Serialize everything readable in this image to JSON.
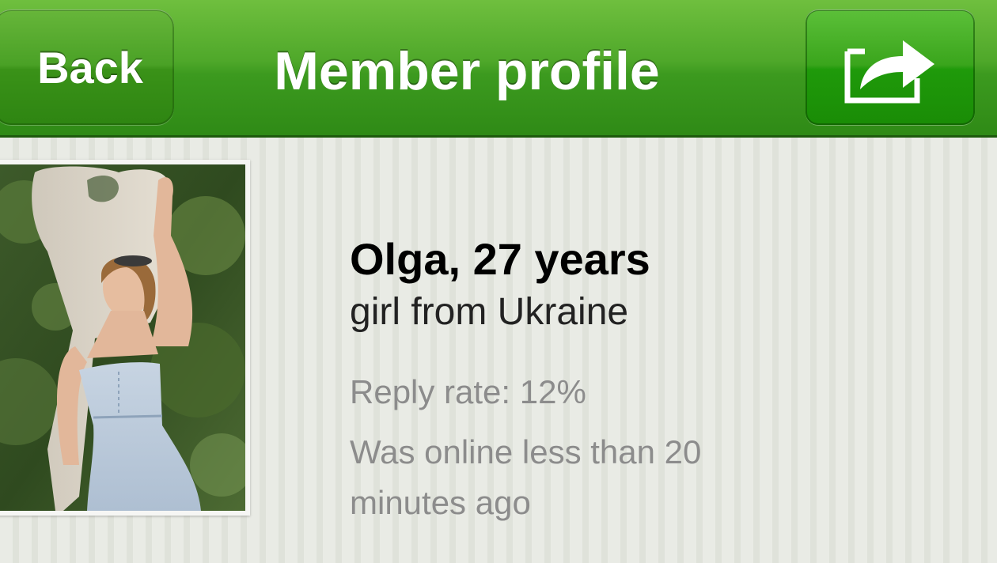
{
  "header": {
    "back_label": "Back",
    "title": "Member profile",
    "share_icon": "share-icon"
  },
  "profile": {
    "name_age": "Olga, 27 years",
    "subtitle": "girl from Ukraine",
    "reply_rate": "Reply rate: 12%",
    "last_online": "Was online less than 20 minutes ago",
    "photo_icon": "profile-photo"
  },
  "colors": {
    "navbar_green": "#3c9a1f",
    "background": "#e7e9e3",
    "text_primary": "#000000",
    "text_secondary": "#8c8c8c"
  }
}
